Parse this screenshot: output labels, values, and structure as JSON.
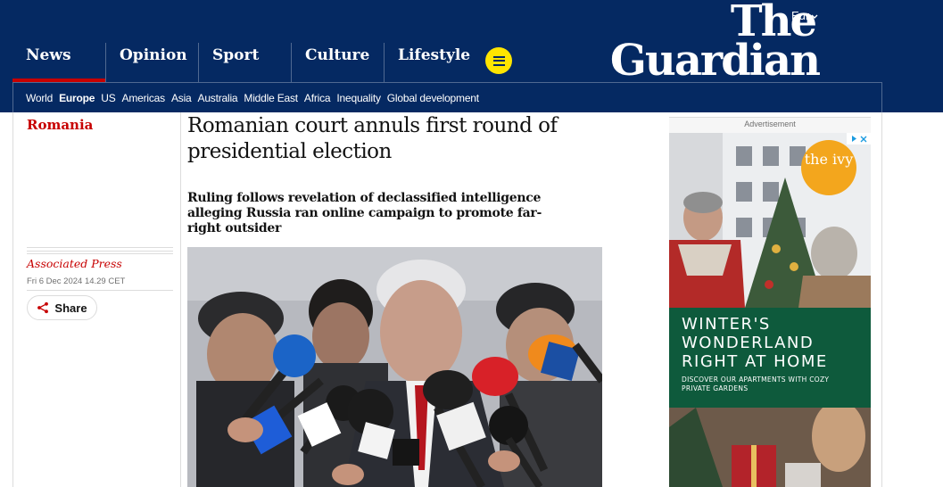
{
  "header": {
    "edition": "Eur",
    "logo_line1": "The",
    "logo_line2": "Guardian",
    "pillars": [
      {
        "label": "News",
        "active": true
      },
      {
        "label": "Opinion",
        "active": false
      },
      {
        "label": "Sport",
        "active": false
      },
      {
        "label": "Culture",
        "active": false
      },
      {
        "label": "Lifestyle",
        "active": false
      }
    ],
    "subnav": [
      "World",
      "Europe",
      "US",
      "Americas",
      "Asia",
      "Australia",
      "Middle East",
      "Africa",
      "Inequality",
      "Global development"
    ],
    "subnav_active": "Europe"
  },
  "article": {
    "section": "Romania",
    "headline": "Romanian court annuls first round of presidential election",
    "standfirst": "Ruling follows revelation of declassified intelligence alleging Russia ran online campaign to promote far-right outsider",
    "byline": "Associated Press",
    "date": "Fri 6 Dec 2024 14.29 CET",
    "share_label": "Share"
  },
  "ad": {
    "label": "Advertisement",
    "brand": "the ivy",
    "headline_lines": [
      "WINTER'S",
      "WONDERLAND",
      "RIGHT AT HOME"
    ],
    "sub": "DISCOVER OUR APARTMENTS WITH COZY PRIVATE GARDENS"
  },
  "colors": {
    "brand_blue": "#052962",
    "news_red": "#c70000",
    "menu_yellow": "#ffe500",
    "ad_green": "#0e5a3c",
    "ad_badge": "#f3a61d"
  },
  "icons": [
    "menu-icon",
    "chevron-down-icon",
    "share-icon",
    "adchoices-icon"
  ]
}
